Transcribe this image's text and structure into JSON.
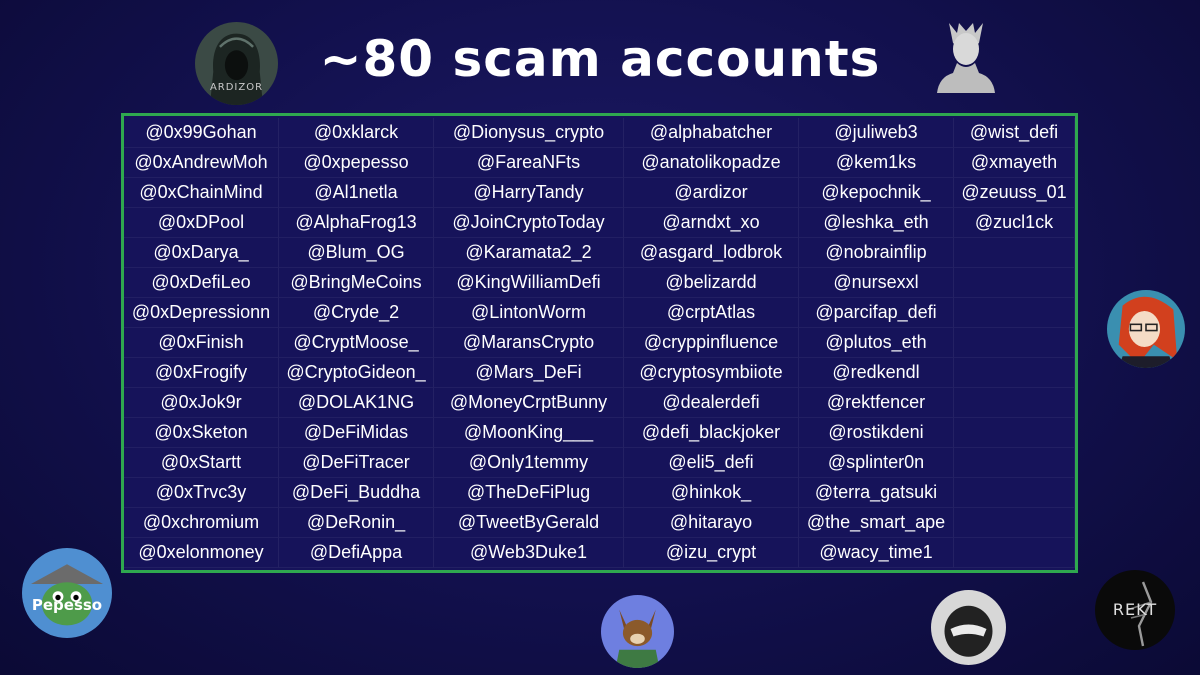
{
  "title": "~80 scam accounts",
  "accent_color": "#2fa84f",
  "avatars": {
    "ardizor": {
      "label": "ARDIZOR",
      "icon": "hooded-figure-icon"
    },
    "pepesso": {
      "label": "Pepesso",
      "icon": "frog-samurai-icon"
    },
    "rekt": {
      "label": "REKT",
      "icon": "skeleton-icon"
    },
    "bust": {
      "icon": "bust-statue-icon"
    },
    "anime": {
      "icon": "anime-girl-icon"
    },
    "dog": {
      "icon": "dog-character-icon"
    },
    "ninja": {
      "icon": "ninja-helmet-icon"
    }
  },
  "columns": [
    [
      "@0x99Gohan",
      "@0xAndrewMoh",
      "@0xChainMind",
      "@0xDPool",
      "@0xDarya_",
      "@0xDefiLeo",
      "@0xDepressionn",
      "@0xFinish",
      "@0xFrogify",
      "@0xJok9r",
      "@0xSketon",
      "@0xStartt",
      "@0xTrvc3y",
      "@0xchromium",
      "@0xelonmoney"
    ],
    [
      "@0xklarck",
      "@0xpepesso",
      "@Al1netla",
      "@AlphaFrog13",
      "@Blum_OG",
      "@BringMeCoins",
      "@Cryde_2",
      "@CryptMoose_",
      "@CryptoGideon_",
      "@DOLAK1NG",
      "@DeFiMidas",
      "@DeFiTracer",
      "@DeFi_Buddha",
      "@DeRonin_",
      "@DefiAppa"
    ],
    [
      "@Dionysus_crypto",
      "@FareaNFts",
      "@HarryTandy",
      "@JoinCryptoToday",
      "@Karamata2_2",
      "@KingWilliamDefi",
      "@LintonWorm",
      "@MaransCrypto",
      "@Mars_DeFi",
      "@MoneyCrptBunny",
      "@MoonKing___",
      "@Only1temmy",
      "@TheDeFiPlug",
      "@TweetByGerald",
      "@Web3Duke1"
    ],
    [
      "@alphabatcher",
      "@anatolikopadze",
      "@ardizor",
      "@arndxt_xo",
      "@asgard_lodbrok",
      "@belizardd",
      "@crptAtlas",
      "@cryppinfluence",
      "@cryptosymbiiote",
      "@dealerdefi",
      "@defi_blackjoker",
      "@eli5_defi",
      "@hinkok_",
      "@hitarayo",
      "@izu_crypt"
    ],
    [
      "@juliweb3",
      "@kem1ks",
      "@kepochnik_",
      "@leshka_eth",
      "@nobrainflip",
      "@nursexxl",
      "@parcifap_defi",
      "@plutos_eth",
      "@redkendl",
      "@rektfencer",
      "@rostikdeni",
      "@splinter0n",
      "@terra_gatsuki",
      "@the_smart_ape",
      "@wacy_time1"
    ],
    [
      "@wist_defi",
      "@xmayeth",
      "@zeuuss_01",
      "@zucl1ck",
      "",
      "",
      "",
      "",
      "",
      "",
      "",
      "",
      "",
      "",
      ""
    ]
  ]
}
